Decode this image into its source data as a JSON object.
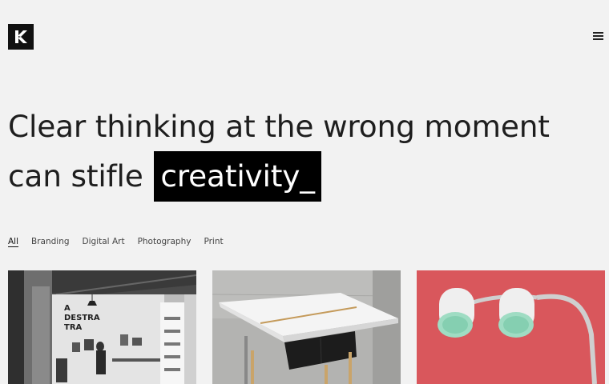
{
  "header": {
    "logo_icon": "k-logo-icon",
    "menu_icon": "hamburger-menu-icon"
  },
  "hero": {
    "line_text": "Clear thinking at the wrong moment can stifle ",
    "highlight": "creativity_"
  },
  "filters": [
    "All",
    "Branding",
    "Digital Art",
    "Photography",
    "Print"
  ],
  "portfolio": [
    {
      "image": "studio-office-photo"
    },
    {
      "image": "white-desk-photo"
    },
    {
      "image": "pink-lamps-photo"
    }
  ],
  "colors": {
    "background": "#f2f2f2",
    "text": "#1e1e1e",
    "highlight_bg": "#000000",
    "highlight_text": "#ffffff",
    "card3_bg": "#d9575c"
  }
}
